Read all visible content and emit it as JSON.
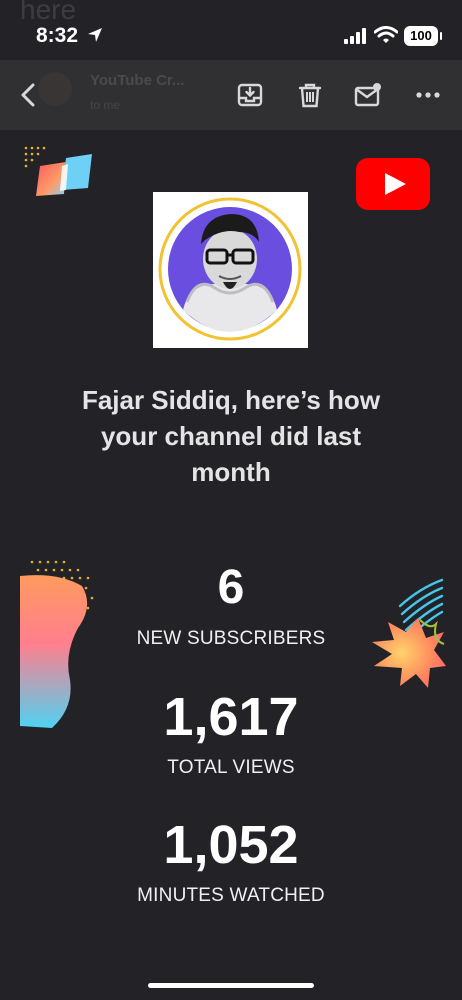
{
  "status_bar": {
    "time": "8:32",
    "battery": "100"
  },
  "ghost_header": {
    "fragment": "here",
    "sender_name": "YouTube Cr...",
    "sender_sub": "to me"
  },
  "email": {
    "headline": "Fajar Siddiq, here’s how your channel did last month",
    "stats": [
      {
        "value": "6",
        "label": "NEW SUBSCRIBERS"
      },
      {
        "value": "1,617",
        "label": "TOTAL VIEWS"
      },
      {
        "value": "1,052",
        "label": "MINUTES WATCHED"
      }
    ]
  },
  "colors": {
    "background": "#232327",
    "toolbar": "#303033",
    "youtube_red": "#ff0000",
    "avatar_ring": "#f2c230",
    "avatar_bg": "#6a4ee0"
  },
  "icons": [
    "location-arrow-icon",
    "signal-icon",
    "wifi-icon",
    "back-chevron-icon",
    "archive-icon",
    "trash-icon",
    "mark-unread-icon",
    "more-icon",
    "youtube-logo-icon"
  ]
}
